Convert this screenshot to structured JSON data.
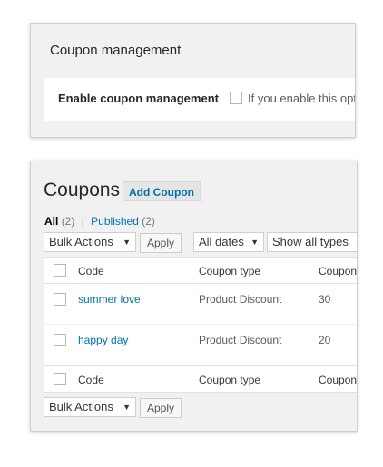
{
  "settings": {
    "title": "Coupon management",
    "enable_label": "Enable coupon management",
    "enable_hint": "If you enable this opt"
  },
  "coupons": {
    "title": "Coupons",
    "add_button": "Add Coupon",
    "filters": {
      "all_label": "All",
      "all_count": "(2)",
      "separator": "|",
      "published_label": "Published",
      "published_count": "(2)"
    },
    "bulk_actions": "Bulk Actions",
    "apply": "Apply",
    "dates": "All dates",
    "types": "Show all types",
    "columns": [
      "Code",
      "Coupon type",
      "Coupon"
    ],
    "rows": [
      {
        "code": "summer love",
        "type": "Product Discount",
        "amount": "30"
      },
      {
        "code": "happy day",
        "type": "Product Discount",
        "amount": "20"
      }
    ]
  }
}
